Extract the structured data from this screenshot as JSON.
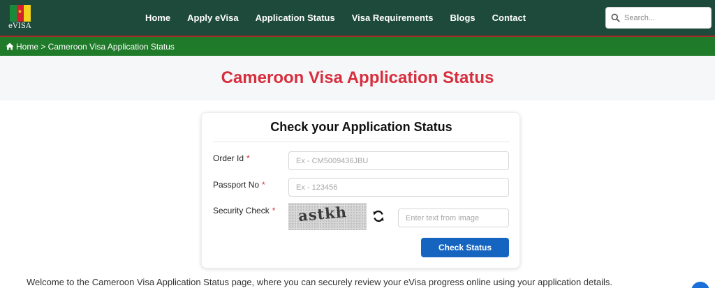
{
  "brand": {
    "logo_text": "eVISA",
    "flag_colors": [
      "#1a8a3a",
      "#d21f2b",
      "#f2d21a"
    ]
  },
  "nav": {
    "items": [
      {
        "label": "Home"
      },
      {
        "label": "Apply eVisa"
      },
      {
        "label": "Application Status"
      },
      {
        "label": "Visa Requirements"
      },
      {
        "label": "Blogs"
      },
      {
        "label": "Contact"
      }
    ],
    "search_placeholder": "Search..."
  },
  "breadcrumb": {
    "text": "Home > Cameroon Visa Application Status"
  },
  "page": {
    "title": "Cameroon Visa Application Status"
  },
  "form": {
    "heading": "Check your Application Status",
    "order_id": {
      "label": "Order Id",
      "required_mark": "*",
      "placeholder": "Ex - CM5009436JBU",
      "value": ""
    },
    "passport_no": {
      "label": "Passport No",
      "required_mark": "*",
      "placeholder": "Ex - 123456",
      "value": ""
    },
    "security_check": {
      "label": "Security Check",
      "required_mark": "*",
      "captcha_text": "astkh",
      "placeholder": "Enter text from image",
      "value": ""
    },
    "submit_label": "Check Status"
  },
  "intro_text": "Welcome to the Cameroon Visa Application Status page, where you can securely review your eVisa progress online using your application details.",
  "colors": {
    "header_bg": "#1d4a3a",
    "breadcrumb_bg": "#1f7a2a",
    "title_red": "#d72e3e",
    "button_blue": "#1565c0"
  }
}
